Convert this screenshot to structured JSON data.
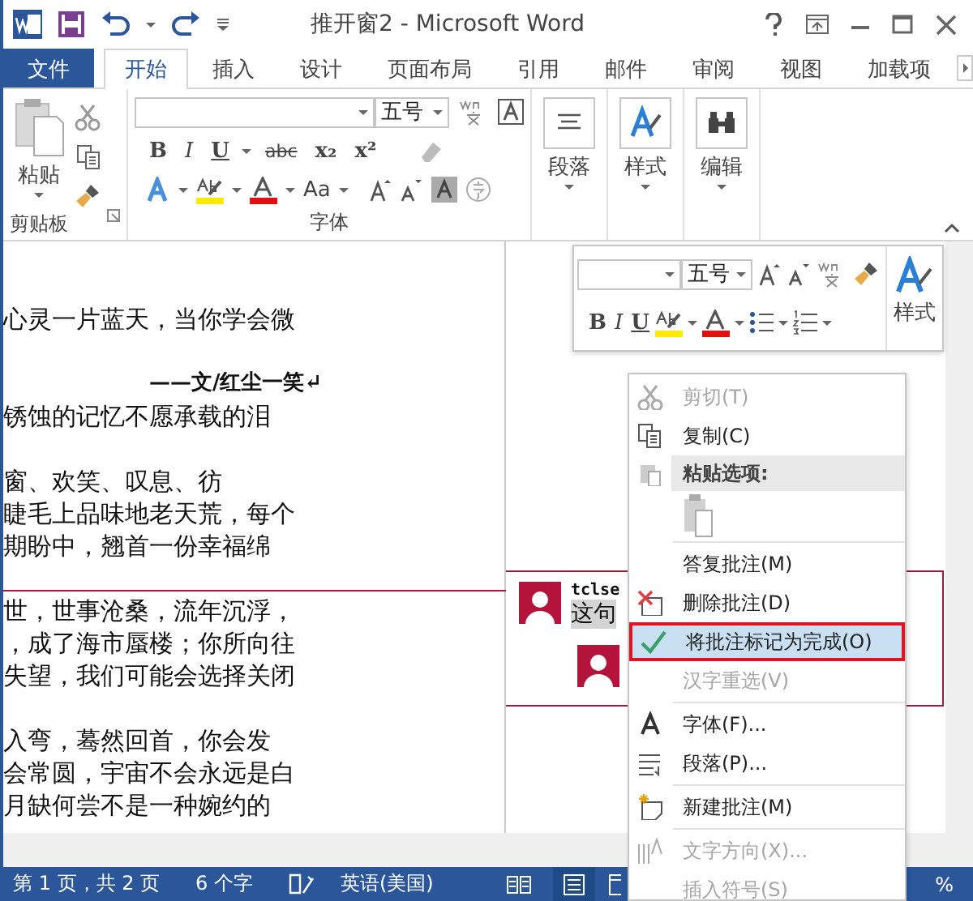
{
  "window": {
    "title": "推开窗2 - Microsoft Word"
  },
  "tabs": [
    {
      "label": "文件",
      "kind": "file",
      "selected": false
    },
    {
      "label": "开始",
      "kind": "tab",
      "selected": true
    },
    {
      "label": "插入",
      "kind": "tab",
      "selected": false
    },
    {
      "label": "设计",
      "kind": "tab",
      "selected": false
    },
    {
      "label": "页面布局",
      "kind": "tab",
      "selected": false
    },
    {
      "label": "引用",
      "kind": "tab",
      "selected": false
    },
    {
      "label": "邮件",
      "kind": "tab",
      "selected": false
    },
    {
      "label": "审阅",
      "kind": "tab",
      "selected": false
    },
    {
      "label": "视图",
      "kind": "tab",
      "selected": false
    },
    {
      "label": "加载项",
      "kind": "tab",
      "selected": false
    }
  ],
  "ribbon": {
    "clipboard": {
      "paste_label": "粘贴",
      "group_label": "剪贴板"
    },
    "font": {
      "size": "五号",
      "format_buttons": [
        "B",
        "I",
        "U",
        "abc",
        "x₂",
        "x²"
      ],
      "case_button": "Aa",
      "group_label": "字体"
    },
    "paragraph_label": "段落",
    "styles_label": "样式",
    "editing_label": "编辑"
  },
  "mini_toolbar": {
    "size": "五号",
    "format_buttons": [
      "B",
      "I",
      "U"
    ],
    "styles_label": "样式"
  },
  "document": {
    "paragraphs": [
      {
        "kind": "body",
        "lines": [
          "心灵一片蓝天，当你学会微"
        ]
      },
      {
        "kind": "byline",
        "lines": [
          "——文/红尘一笑↵"
        ]
      },
      {
        "kind": "body",
        "lines": [
          "锈蚀的记忆不愿承载的泪"
        ]
      },
      {
        "kind": "body",
        "lines": [
          "窗、欢笑、叹息、彷",
          "睫毛上品味地老天荒，每个",
          "期盼中，翘首一份幸福绵"
        ]
      },
      {
        "kind": "body",
        "lines": [
          "世，世事沧桑，流年沉浮，",
          "，成了海市蜃楼；你所向往",
          "失望，我们可能会选择关闭"
        ]
      },
      {
        "kind": "body",
        "lines": [
          "入弯，蓦然回首，你会发",
          "会常圆，宇宙不会永远是白",
          "月缺何尝不是一种婉约的"
        ]
      }
    ]
  },
  "comment": {
    "author": "tclse",
    "text": "这句"
  },
  "context_menu": {
    "items": [
      {
        "kind": "item",
        "label": "剪切(T)",
        "disabled": true,
        "selected": false
      },
      {
        "kind": "item",
        "label": "复制(C)",
        "disabled": false,
        "selected": false
      },
      {
        "kind": "header",
        "label": "粘贴选项:"
      },
      {
        "kind": "paste"
      },
      {
        "kind": "separator"
      },
      {
        "kind": "item",
        "label": "答复批注(M)",
        "disabled": false,
        "selected": false
      },
      {
        "kind": "item",
        "label": "删除批注(D)",
        "disabled": false,
        "selected": false
      },
      {
        "kind": "item",
        "label": "将批注标记为完成(O)",
        "disabled": false,
        "selected": true
      },
      {
        "kind": "item",
        "label": "汉字重选(V)",
        "disabled": true,
        "selected": false
      },
      {
        "kind": "separator"
      },
      {
        "kind": "item",
        "label": "字体(F)...",
        "disabled": false,
        "selected": false
      },
      {
        "kind": "item",
        "label": "段落(P)...",
        "disabled": false,
        "selected": false
      },
      {
        "kind": "separator"
      },
      {
        "kind": "item",
        "label": "新建批注(M)",
        "disabled": false,
        "selected": false
      },
      {
        "kind": "separator"
      },
      {
        "kind": "item",
        "label": "文字方向(X)...",
        "disabled": true,
        "selected": false
      },
      {
        "kind": "item",
        "label": "插入符号(S)",
        "disabled": true,
        "selected": false
      }
    ]
  },
  "status_bar": {
    "page": "第 1 页，共 2 页",
    "words": "6 个字",
    "language": "英语(美国)",
    "views": [
      {
        "kind": "read",
        "selected": false
      },
      {
        "kind": "print",
        "selected": true
      },
      {
        "kind": "web",
        "selected": false
      }
    ],
    "zoom": "%"
  }
}
